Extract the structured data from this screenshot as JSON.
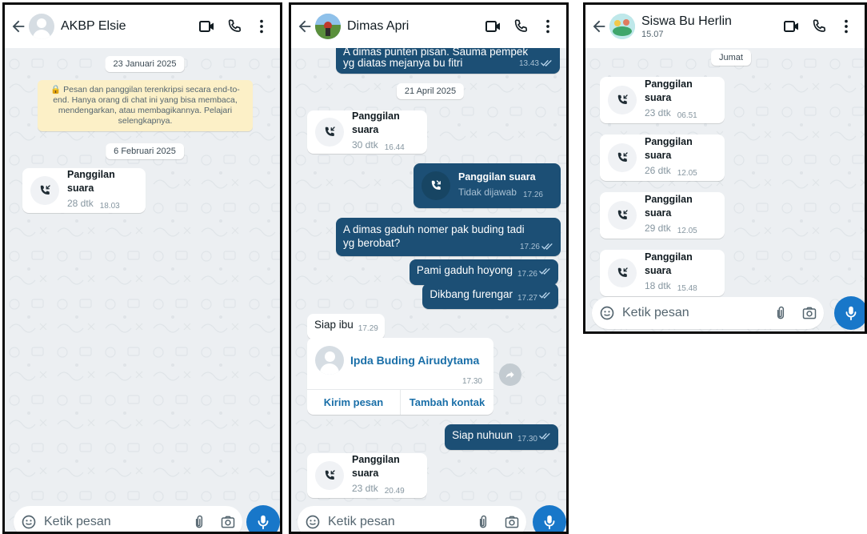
{
  "colors": {
    "chat_background": "#eceff2",
    "outgoing_bubble": "#1c4f75",
    "incoming_bubble": "#ffffff",
    "encryption_notice": "#fcf0c7",
    "mic_button": "#1877c9",
    "read_ticks": "#bcd8ee",
    "contact_link": "#1a6fa8"
  },
  "icons": {
    "back": "arrow-left-icon",
    "video_call": "video-camera-icon",
    "voice_call": "phone-icon",
    "menu": "kebab-menu-icon",
    "emoji": "emoji-icon",
    "attach": "paperclip-icon",
    "camera": "camera-icon",
    "mic": "microphone-icon",
    "missed_call": "missed-call-icon",
    "incoming_call": "incoming-call-icon",
    "forward": "forward-icon"
  },
  "composer": {
    "placeholder": "Ketik pesan"
  },
  "chat1": {
    "contact_name": "AKBP Elsie",
    "date1": "23 Januari 2025",
    "encryption_notice": "🔒 Pesan dan panggilan terenkripsi secara end-to-end. Hanya orang di chat ini yang bisa membaca, mendengarkan, atau membagikannya. Pelajari selengkapnya.",
    "date2": "6 Februari 2025",
    "call": {
      "title": "Panggilan suara",
      "duration": "28 dtk",
      "time": "18.03"
    }
  },
  "chat2": {
    "contact_name": "Dimas Apri",
    "top_message": {
      "line1": "A dimas punten pisan. Sauma pempek",
      "line2": "yg diatas mejanya bu fitri",
      "time": "13.43"
    },
    "date": "21 April 2025",
    "call1": {
      "title": "Panggilan suara",
      "duration": "30 dtk",
      "time": "16.44"
    },
    "call2": {
      "title": "Panggilan suara",
      "status": "Tidak dijawab",
      "time": "17.26"
    },
    "msg1": {
      "line1": "A dimas gaduh nomer pak buding tadi",
      "line2": "yg berobat?",
      "time": "17.26"
    },
    "msg2": {
      "text": "Pami gaduh hoyong",
      "time": "17.26"
    },
    "msg3": {
      "text": "Dikbang furengar",
      "time": "17.27"
    },
    "msg4": {
      "text": "Siap ibu",
      "time": "17.29"
    },
    "contact_card": {
      "name": "Ipda Buding Airudytama",
      "time": "17.30",
      "send_label": "Kirim pesan",
      "add_label": "Tambah kontak"
    },
    "msg5": {
      "text": "Siap nuhuun",
      "time": "17.30"
    },
    "call3": {
      "title": "Panggilan suara",
      "duration": "23 dtk",
      "time": "20.49"
    }
  },
  "chat3": {
    "contact_name": "Siswa Bu Herlin",
    "subtitle": "15.07",
    "day": "Jumat",
    "calls": [
      {
        "title": "Panggilan suara",
        "duration": "23 dtk",
        "time": "06.51"
      },
      {
        "title": "Panggilan suara",
        "duration": "26 dtk",
        "time": "12.05"
      },
      {
        "title": "Panggilan suara",
        "duration": "29 dtk",
        "time": "12.05"
      },
      {
        "title": "Panggilan suara",
        "duration": "18 dtk",
        "time": "15.48"
      }
    ]
  }
}
